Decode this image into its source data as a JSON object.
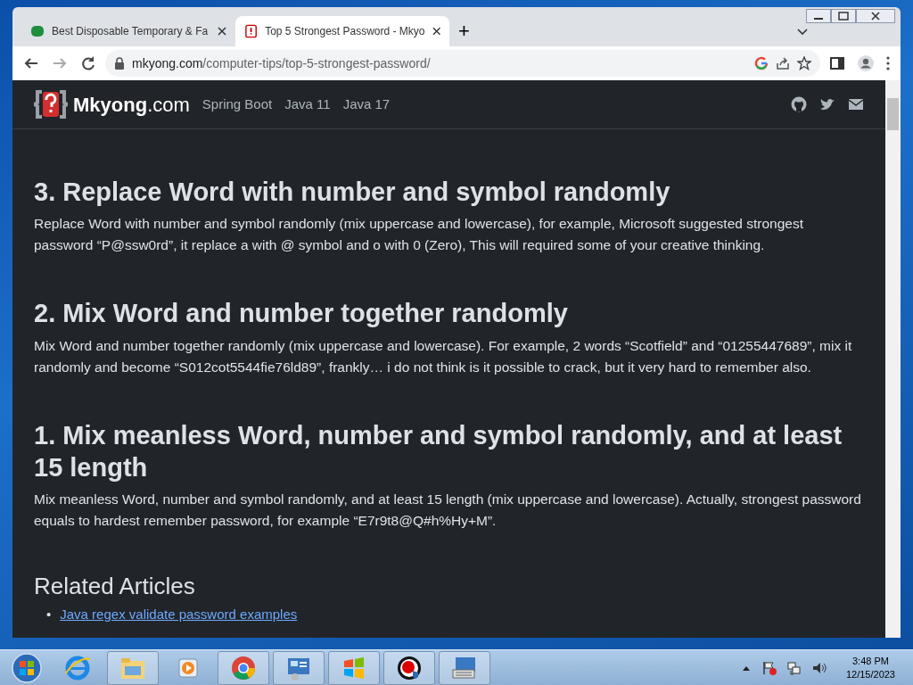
{
  "browser": {
    "tabs": [
      {
        "title": "Best Disposable Temporary & Fa",
        "selected": false
      },
      {
        "title": "Top 5 Strongest Password - Mkyo",
        "selected": true
      }
    ],
    "new_tab": "+",
    "url_host": "mkyong.com",
    "url_path": "/computer-tips/top-5-strongest-password/"
  },
  "site_nav": {
    "brand": "Mkyong",
    "brand_suffix": ".com",
    "links": [
      "Spring Boot",
      "Java 11",
      "Java 17"
    ]
  },
  "sections": [
    {
      "heading": "3. Replace Word with number and symbol randomly",
      "text": "Replace Word with number and symbol randomly (mix uppercase and lowercase), for example, Microsoft suggested strongest password “P@ssw0rd”, it replace a with @ symbol and o with 0 (Zero), This will required some of your creative thinking."
    },
    {
      "heading": "2. Mix Word and number together randomly",
      "text": "Mix Word and number together randomly (mix uppercase and lowercase). For example, 2 words “Scotfield” and “01255447689”, mix it randomly and become “S012cot5544fie76ld89”, frankly… i do not think is it possible to crack, but it very hard to remember also."
    },
    {
      "heading": "1. Mix meanless Word, number and symbol randomly, and at least 15 length",
      "text": "Mix meanless Word, number and symbol randomly, and at least 15 length (mix uppercase and lowercase). Actually, strongest password equals to hardest remember password, for example “E7r9t8@Q#h%Hy+M”."
    }
  ],
  "related": {
    "heading": "Related Articles",
    "bullet": "•",
    "links": [
      "Java regex validate password examples"
    ]
  },
  "taskbar": {
    "time": "3:48 PM",
    "date": "12/15/2023"
  }
}
